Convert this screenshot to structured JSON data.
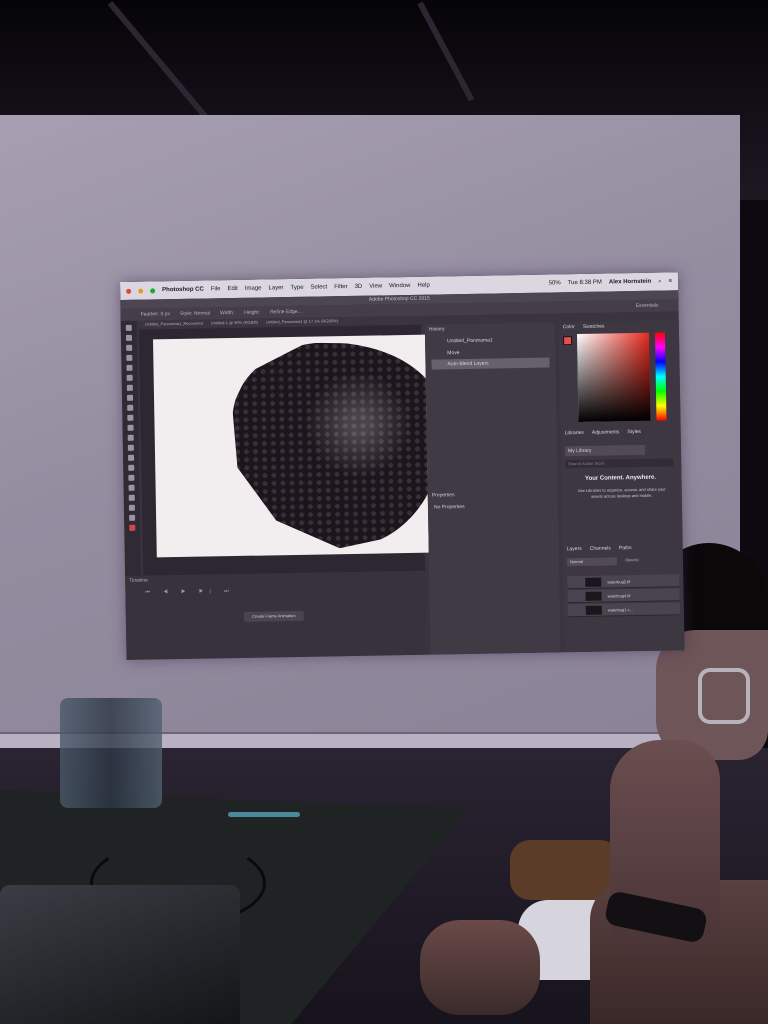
{
  "photoshop": {
    "menubar": {
      "app": "Photoshop CC",
      "menus": [
        "File",
        "Edit",
        "Image",
        "Layer",
        "Type",
        "Select",
        "Filter",
        "3D",
        "View",
        "Window",
        "Help"
      ],
      "battery": "50%",
      "clock": "Tue 8:38 PM",
      "user": "Alex Hornstein"
    },
    "window_title": "Adobe Photoshop CC 2015",
    "options": {
      "feather": "Feather: 0 px",
      "style": "Style: Normal",
      "width": "Width:",
      "height": "Height:",
      "refine": "Refine Edge...",
      "workspace": "Essentials"
    },
    "doc_tabs": [
      "Untitled_Panorama1_Recovered",
      "Untitled-1 @ 50% (RGB/8)",
      "Untitled_Panorama1 @ 17.1% (RGB/8#)"
    ],
    "timeline": {
      "label": "Timeline",
      "controls": "⏮ ◀ ▶ ▶| ⏭",
      "create_button": "Create Frame Animation"
    },
    "history": {
      "tab": "History",
      "items": [
        "Untitled_Panorama1",
        "Move",
        "Auto-Blend Layers"
      ]
    },
    "properties": {
      "tab": "Properties",
      "empty": "No Properties"
    },
    "color_panel": {
      "tabs": [
        "Color",
        "Swatches"
      ],
      "foreground": "#e05050"
    },
    "libraries": {
      "tabs": [
        "Libraries",
        "Adjustments",
        "Styles"
      ],
      "selected": "My Library",
      "search_placeholder": "Search Adobe Stock",
      "heading": "Your Content. Anywhere.",
      "body": "Use Libraries to organize, access, and share your assets across desktop and mobile."
    },
    "layers": {
      "tabs": [
        "Layers",
        "Channels",
        "Paths"
      ],
      "mode": "Normal",
      "opacity": "Opacity:",
      "items": [
        "waterbug2.tif",
        "waterbug4.tif",
        "waterbug1 c..."
      ]
    }
  }
}
